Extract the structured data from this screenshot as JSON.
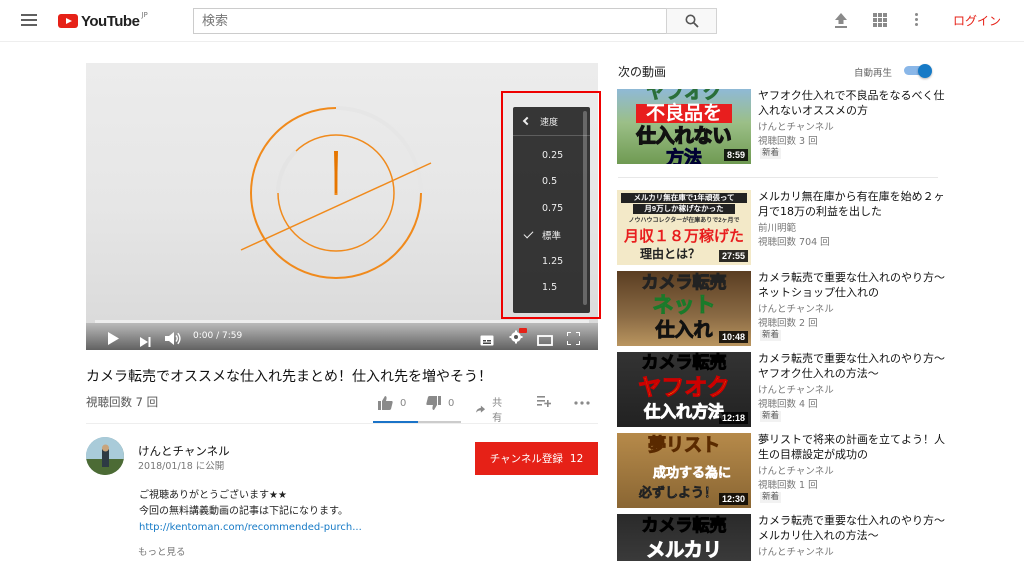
{
  "header": {
    "logo_text": "YouTube",
    "logo_region": "JP",
    "search_placeholder": "検索",
    "login_label": "ログイン",
    "icons": [
      "menu-icon",
      "search-icon",
      "upload-icon",
      "apps-icon",
      "more-vert-icon"
    ]
  },
  "player": {
    "time_display": "0:00 / 7:59",
    "progress_fraction": 0.0,
    "speed_menu": {
      "title": "速度",
      "options": [
        "0.25",
        "0.5",
        "0.75",
        "標準",
        "1.25",
        "1.5"
      ],
      "selected": "標準"
    },
    "highlight_color": "#e00000"
  },
  "video": {
    "title": "カメラ転売でオススメな仕入れ先まとめ！仕入れ先を増やそう！",
    "views": "視聴回数 7 回",
    "likes": "0",
    "dislikes": "0",
    "share_label": "共有"
  },
  "channel": {
    "name": "けんとチャンネル",
    "published": "2018/01/18 に公開",
    "subscribe_label": "チャンネル登録",
    "subscriber_count": "12"
  },
  "description": {
    "line1": "ご視聴ありがとうございます★★",
    "line2": "今回の無料講義動画の記事は下記になります。",
    "link": "http://kentoman.com/recommended-purch...",
    "show_more": "もっと見る"
  },
  "sidebar": {
    "up_next_label": "次の動画",
    "autoplay_label": "自動再生",
    "autoplay_on": true,
    "items": [
      {
        "title": "ヤフオク仕入れで不良品をなるべく仕入れないオススメの方",
        "channel": "けんとチャンネル",
        "views": "視聴回数 3 回",
        "badge": "新着",
        "duration": "8:59",
        "thumb_text": [
          "ヤフオク",
          "不良品を",
          "仕入れない",
          "方法"
        ]
      },
      {
        "title": "メルカリ無在庫から有在庫を始め２ヶ月で18万の利益を出した",
        "channel": "前川明範",
        "views": "視聴回数 704 回",
        "badge": "",
        "duration": "27:55",
        "thumb_text": [
          "メルカリ無在庫で1年頑張って",
          "月9万しか稼げなかった",
          "ノウハウコレクターが在庫ありで2ヶ月で",
          "月収１８万稼げた",
          "理由とは？"
        ]
      },
      {
        "title": "カメラ転売で重要な仕入れのやり方〜ネットショップ仕入れの",
        "channel": "けんとチャンネル",
        "views": "視聴回数 2 回",
        "badge": "新着",
        "duration": "10:48",
        "thumb_text": [
          "カメラ転売",
          "ネット",
          "仕入れ"
        ]
      },
      {
        "title": "カメラ転売で重要な仕入れのやり方〜ヤフオク仕入れの方法〜",
        "channel": "けんとチャンネル",
        "views": "視聴回数 4 回",
        "badge": "新着",
        "duration": "12:18",
        "thumb_text": [
          "カメラ転売",
          "ヤフオク",
          "仕入れ方法"
        ]
      },
      {
        "title": "夢リストで将来の計画を立てよう！人生の目標設定が成功の",
        "channel": "けんとチャンネル",
        "views": "視聴回数 1 回",
        "badge": "新着",
        "duration": "12:30",
        "thumb_text": [
          "夢リスト",
          "成功する為に",
          "必ずしよう！"
        ]
      },
      {
        "title": "カメラ転売で重要な仕入れのやり方〜メルカリ仕入れの方法〜",
        "channel": "けんとチャンネル",
        "views": "",
        "badge": "",
        "duration": "",
        "thumb_text": [
          "カメラ転売",
          "メルカリ"
        ]
      }
    ]
  }
}
